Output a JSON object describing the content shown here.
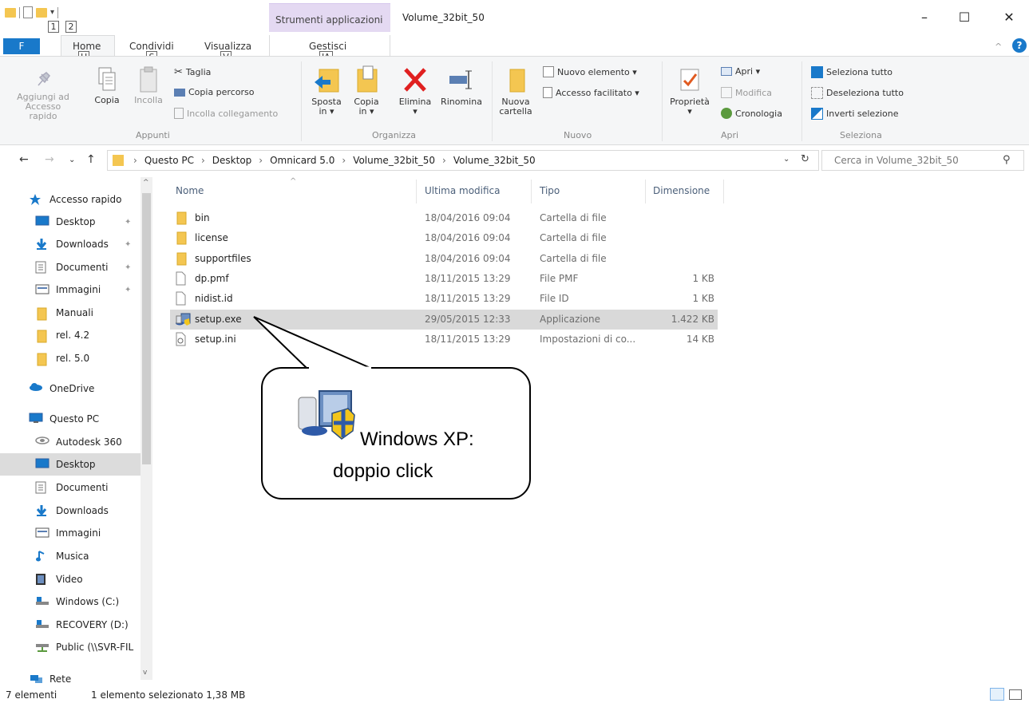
{
  "window": {
    "title": "Volume_32bit_50",
    "contextual_tab": "Strumenti applicazioni",
    "minimize": "–",
    "maximize": "☐",
    "close": "✕"
  },
  "qat_keytips": [
    "1",
    "2"
  ],
  "tabs": {
    "file": "F",
    "home": "Home",
    "share": "Condividi",
    "view": "Visualizza",
    "manage": "Gestisci",
    "keytips": {
      "home": "H",
      "share": "S",
      "view": "V",
      "manage": "JA"
    }
  },
  "ribbon": {
    "clipboard": {
      "label": "Appunti",
      "pin": "Aggiungi ad\nAccesso rapido",
      "pin_line1": "Aggiungi ad",
      "pin_line2": "Accesso rapido",
      "copy": "Copia",
      "paste": "Incolla",
      "cut": "Taglia",
      "copy_path": "Copia percorso",
      "paste_shortcut": "Incolla collegamento"
    },
    "organize": {
      "label": "Organizza",
      "move_line1": "Sposta",
      "move_line2": "in ▾",
      "copy_line1": "Copia",
      "copy_line2": "in ▾",
      "delete": "Elimina",
      "rename": "Rinomina"
    },
    "new": {
      "label": "Nuovo",
      "new_folder_line1": "Nuova",
      "new_folder_line2": "cartella",
      "new_item": "Nuovo elemento ▾",
      "easy_access": "Accesso facilitato ▾"
    },
    "open": {
      "label": "Apri",
      "properties": "Proprietà",
      "open": "Apri ▾",
      "edit": "Modifica",
      "history": "Cronologia"
    },
    "select": {
      "label": "Seleziona",
      "select_all": "Seleziona tutto",
      "select_none": "Deseleziona tutto",
      "invert": "Inverti selezione"
    }
  },
  "address": {
    "crumbs": [
      "Questo PC",
      "Desktop",
      "Omnicard 5.0",
      "Volume_32bit_50",
      "Volume_32bit_50"
    ],
    "search_placeholder": "Cerca in Volume_32bit_50"
  },
  "nav_pane": [
    {
      "label": "Accesso rapido",
      "icon": "star-icon"
    },
    {
      "label": "Desktop",
      "icon": "desktop-icon",
      "pinned": true
    },
    {
      "label": "Downloads",
      "icon": "download-icon",
      "pinned": true
    },
    {
      "label": "Documenti",
      "icon": "document-icon",
      "pinned": true
    },
    {
      "label": "Immagini",
      "icon": "image-icon",
      "pinned": true
    },
    {
      "label": "Manuali",
      "icon": "folder-icon"
    },
    {
      "label": "rel. 4.2",
      "icon": "folder-icon"
    },
    {
      "label": "rel. 5.0",
      "icon": "folder-icon"
    },
    {
      "label": "OneDrive",
      "icon": "cloud-icon"
    },
    {
      "label": "Questo PC",
      "icon": "computer-icon"
    },
    {
      "label": "Autodesk 360",
      "icon": "autodesk-icon"
    },
    {
      "label": "Desktop",
      "icon": "desktop-icon"
    },
    {
      "label": "Documenti",
      "icon": "document-icon"
    },
    {
      "label": "Downloads",
      "icon": "download-icon"
    },
    {
      "label": "Immagini",
      "icon": "image-icon"
    },
    {
      "label": "Musica",
      "icon": "music-icon"
    },
    {
      "label": "Video",
      "icon": "video-icon"
    },
    {
      "label": "Windows (C:)",
      "icon": "drive-icon"
    },
    {
      "label": "RECOVERY (D:)",
      "icon": "drive-icon"
    },
    {
      "label": "Public (\\\\SVR-FIL",
      "icon": "network-drive-icon"
    },
    {
      "label": "Rete",
      "icon": "network-icon"
    }
  ],
  "columns": {
    "name": "Nome",
    "modified": "Ultima modifica",
    "type": "Tipo",
    "size": "Dimensione"
  },
  "files": [
    {
      "name": "bin",
      "modified": "18/04/2016 09:04",
      "type": "Cartella di file",
      "size": "",
      "icon": "folder-icon"
    },
    {
      "name": "license",
      "modified": "18/04/2016 09:04",
      "type": "Cartella di file",
      "size": "",
      "icon": "folder-icon"
    },
    {
      "name": "supportfiles",
      "modified": "18/04/2016 09:04",
      "type": "Cartella di file",
      "size": "",
      "icon": "folder-icon"
    },
    {
      "name": "dp.pmf",
      "modified": "18/11/2015 13:29",
      "type": "File PMF",
      "size": "1 KB",
      "icon": "file-icon"
    },
    {
      "name": "nidist.id",
      "modified": "18/11/2015 13:29",
      "type": "File ID",
      "size": "1 KB",
      "icon": "file-icon"
    },
    {
      "name": "setup.exe",
      "modified": "29/05/2015 12:33",
      "type": "Applicazione",
      "size": "1.422 KB",
      "icon": "installer-icon",
      "selected": true
    },
    {
      "name": "setup.ini",
      "modified": "18/11/2015 13:29",
      "type": "Impostazioni di co...",
      "size": "14 KB",
      "icon": "settings-file-icon"
    }
  ],
  "callout": {
    "line1": "Windows XP:",
    "line2": "doppio click"
  },
  "status": {
    "count": "7 elementi",
    "selection": "1 elemento selezionato  1,38 MB"
  },
  "colors": {
    "accent": "#1979ca",
    "folder": "#f4c651",
    "selection": "#d9d9d9",
    "contextual_tab": "#e4d9f2"
  }
}
